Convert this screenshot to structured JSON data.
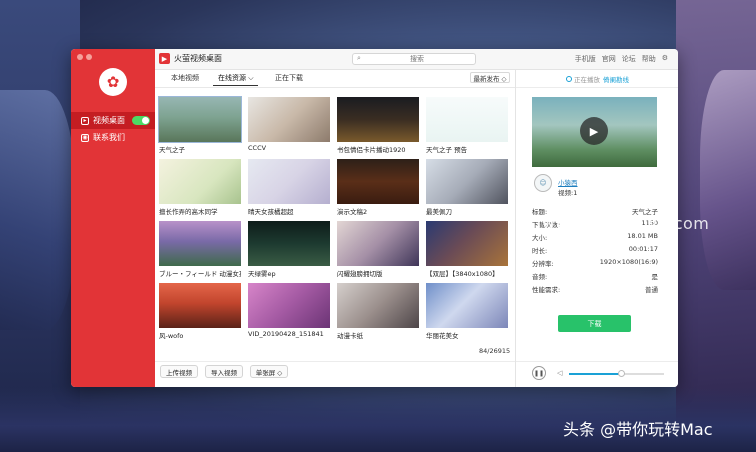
{
  "sidebar": {
    "items": [
      {
        "label": "视频桌面",
        "icon": "video-icon",
        "active": true
      },
      {
        "label": "联系我们",
        "icon": "contact-icon",
        "active": false
      }
    ]
  },
  "titlebar": {
    "app_title": "火萤视频桌面",
    "search_placeholder": "搜索",
    "links": [
      "手机版",
      "官网",
      "论坛",
      "帮助"
    ]
  },
  "tabs": [
    "本地视频",
    "在线资源 ⌵",
    "正在下载"
  ],
  "sort_label": "最新发布 ◇",
  "videos": [
    {
      "caption": "天气之子",
      "color": "linear-gradient(180deg,#97b6b3 0%,#7ea391 45%,#59765a 100%)",
      "selected": true
    },
    {
      "caption": "CCCV",
      "color": "linear-gradient(135deg,#e8e6e2 0%,#c9b9a9 50%,#8d7b6c 100%)"
    },
    {
      "caption": "书包情侣卡片播动1920",
      "color": "linear-gradient(180deg,#1a1c21 0%,#3a2d22 50%,#7a5a2c 100%)"
    },
    {
      "caption": "天气之子 预告",
      "color": "linear-gradient(180deg,#f7fbfb 0%,#e9f4f2 100%)"
    },
    {
      "caption": "擅长作弄的高木同学",
      "color": "linear-gradient(135deg,#f4f2df 0%,#d8e6bf 60%,#a8c38e 100%)"
    },
    {
      "caption": "晴天女孩橘超超",
      "color": "linear-gradient(135deg,#e6e9f1 0%,#d8d4e6 50%,#b5afcf 100%)"
    },
    {
      "caption": "演示文稿2",
      "color": "linear-gradient(180deg,#2d2018 0%,#5a2e18 50%,#3a1c10 100%)"
    },
    {
      "caption": "最美佩刀",
      "color": "linear-gradient(135deg,#d6dde6 0%,#a6acb8 50%,#50535e 100%)"
    },
    {
      "caption": "ブルー・フィールド 动漫女孩",
      "color": "linear-gradient(180deg,#b892c9 0%,#7a6aa8 45%,#3f6a4b 100%)"
    },
    {
      "caption": "天绿雾ep",
      "color": "linear-gradient(180deg,#0e1c1a 0%,#1d3a30 50%,#3a5c44 100%)"
    },
    {
      "caption": "闪耀翅膀拥切版",
      "color": "linear-gradient(135deg,#e3d6d4 0%,#a48fa6 50%,#3f3558 100%)"
    },
    {
      "caption": "【双层】【3840x1080】",
      "color": "linear-gradient(135deg,#2a3a72 0%,#6a4b56 45%,#a9743a 100%)"
    },
    {
      "caption": "风-wofo",
      "color": "linear-gradient(180deg,#e4664a 0%,#c2452d 45%,#5a2218 100%)"
    },
    {
      "caption": "VID_20190428_151841",
      "color": "linear-gradient(135deg,#d785c9 0%,#a45aa3 50%,#6b3475 100%)"
    },
    {
      "caption": "动漫卡纸",
      "color": "linear-gradient(135deg,#d5cfcc 0%,#9b8f8c 50%,#4d4548 100%)"
    },
    {
      "caption": "华丽花美女",
      "color": "linear-gradient(135deg,#6f8fc9 0%,#cfd8ee 45%,#7c86b8 100%)"
    }
  ],
  "page_count": "84/26915",
  "bottom_buttons": [
    "上传视频",
    "导入视频",
    "单张屏 ◇"
  ],
  "detail": {
    "header_prefix": "正在播放",
    "header_title": "倚阑勘线",
    "uploader": "小猿西",
    "video_count": "视频:1",
    "rows": [
      {
        "key": "标题:",
        "val": "天气之子"
      },
      {
        "key": "下载次数:",
        "val": "1150"
      },
      {
        "key": "大小:",
        "val": "18.01 MB"
      },
      {
        "key": "时长:",
        "val": "00:01:17"
      },
      {
        "key": "分辨率:",
        "val": "1920×1080(16:9)"
      },
      {
        "key": "音频:",
        "val": "是"
      },
      {
        "key": "性能需求:",
        "val": "普通"
      }
    ],
    "download_label": "下载",
    "volume": 0.55
  },
  "watermark": "www.MacDown.com",
  "footer_brand": "头条 @带你玩转Mac"
}
